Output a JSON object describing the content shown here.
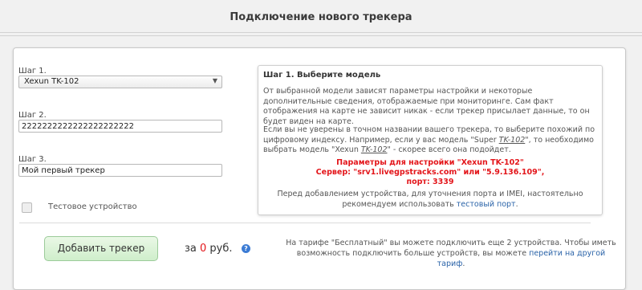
{
  "page_title": "Подключение нового трекера",
  "step1": {
    "label": "Шаг 1.",
    "selected": "Xexun TK-102",
    "arrow": "▼"
  },
  "step2": {
    "label": "Шаг 2.",
    "value": "2222222222222222222222"
  },
  "step3": {
    "label": "Шаг 3.",
    "value": "Мой первый трекер"
  },
  "test_device": {
    "label": "Тестовое устройство",
    "checked": false
  },
  "info": {
    "title": "Шаг 1. Выберите модель",
    "para1": "От выбранной модели зависят параметры настройки и некоторые дополнительные сведения, отображаемые при мониторинге. Сам факт отображения на карте не зависит никак - если трекер присылает данные, то он будет виден на карте.",
    "para2_before": "Если вы не уверены в точном названии вашего трекера, то выберите похожий по цифровому индексу. Например, если у вас модель \"Super ",
    "para2_model1": "TK-102",
    "para2_middle": "\", то необходимо выбрать модель \"Xexun ",
    "para2_model2": "TK-102",
    "para2_after": "\" - скорее всего она подойдет.",
    "params_line1": "Параметры для настройки \"Xexun TK-102\"",
    "params_line2": "Сервер: \"srv1.livegpstracks.com\" или \"5.9.136.109\",",
    "params_line3": "порт: 3339",
    "bottom_text": "Перед добавлением устройства, для уточнения порта и IMEI, настоятельно рекомендуем использовать ",
    "bottom_link": "тестовый порт",
    "bottom_end": "."
  },
  "add_button": "Добавить трекер",
  "price": {
    "prefix": "за ",
    "value": "0",
    "suffix": " руб."
  },
  "help_icon_glyph": "?",
  "tariff_note": {
    "text": "На тарифе \"Бесплатный\" вы можете подключить еще 2 устройства. Чтобы иметь возможность подключить больше устройств, вы можете ",
    "link": "перейти на другой тариф",
    "end": "."
  }
}
